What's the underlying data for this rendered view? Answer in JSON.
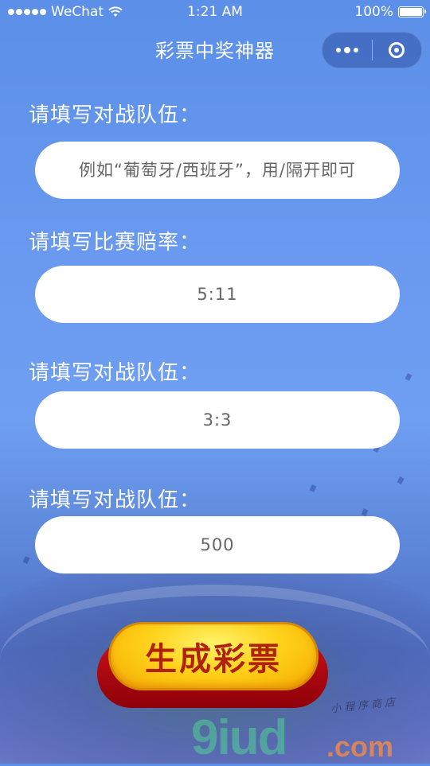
{
  "status_bar": {
    "carrier": "WeChat",
    "time": "1:21 AM",
    "battery": "100%"
  },
  "nav": {
    "title": "彩票中奖神器"
  },
  "form": {
    "fields": [
      {
        "label": "请填写对战队伍：",
        "value": "",
        "placeholder": "例如“葡萄牙/西班牙”，用/隔开即可"
      },
      {
        "label": "请填写比赛赔率：",
        "value": "",
        "placeholder": "5:11"
      },
      {
        "label": "请填写对战队伍：",
        "value": "",
        "placeholder": "3:3"
      },
      {
        "label": "请填写对战队伍：",
        "value": "",
        "placeholder": "500"
      }
    ],
    "submit_label": "生成彩票"
  },
  "watermark": {
    "logo": "9iud",
    "suffix": ".com",
    "caption": "小程序商店"
  },
  "colors": {
    "background": "#6a9af0",
    "button_gold": "#ffd21a",
    "button_text": "#b0210e",
    "button_base": "#c8101a"
  }
}
